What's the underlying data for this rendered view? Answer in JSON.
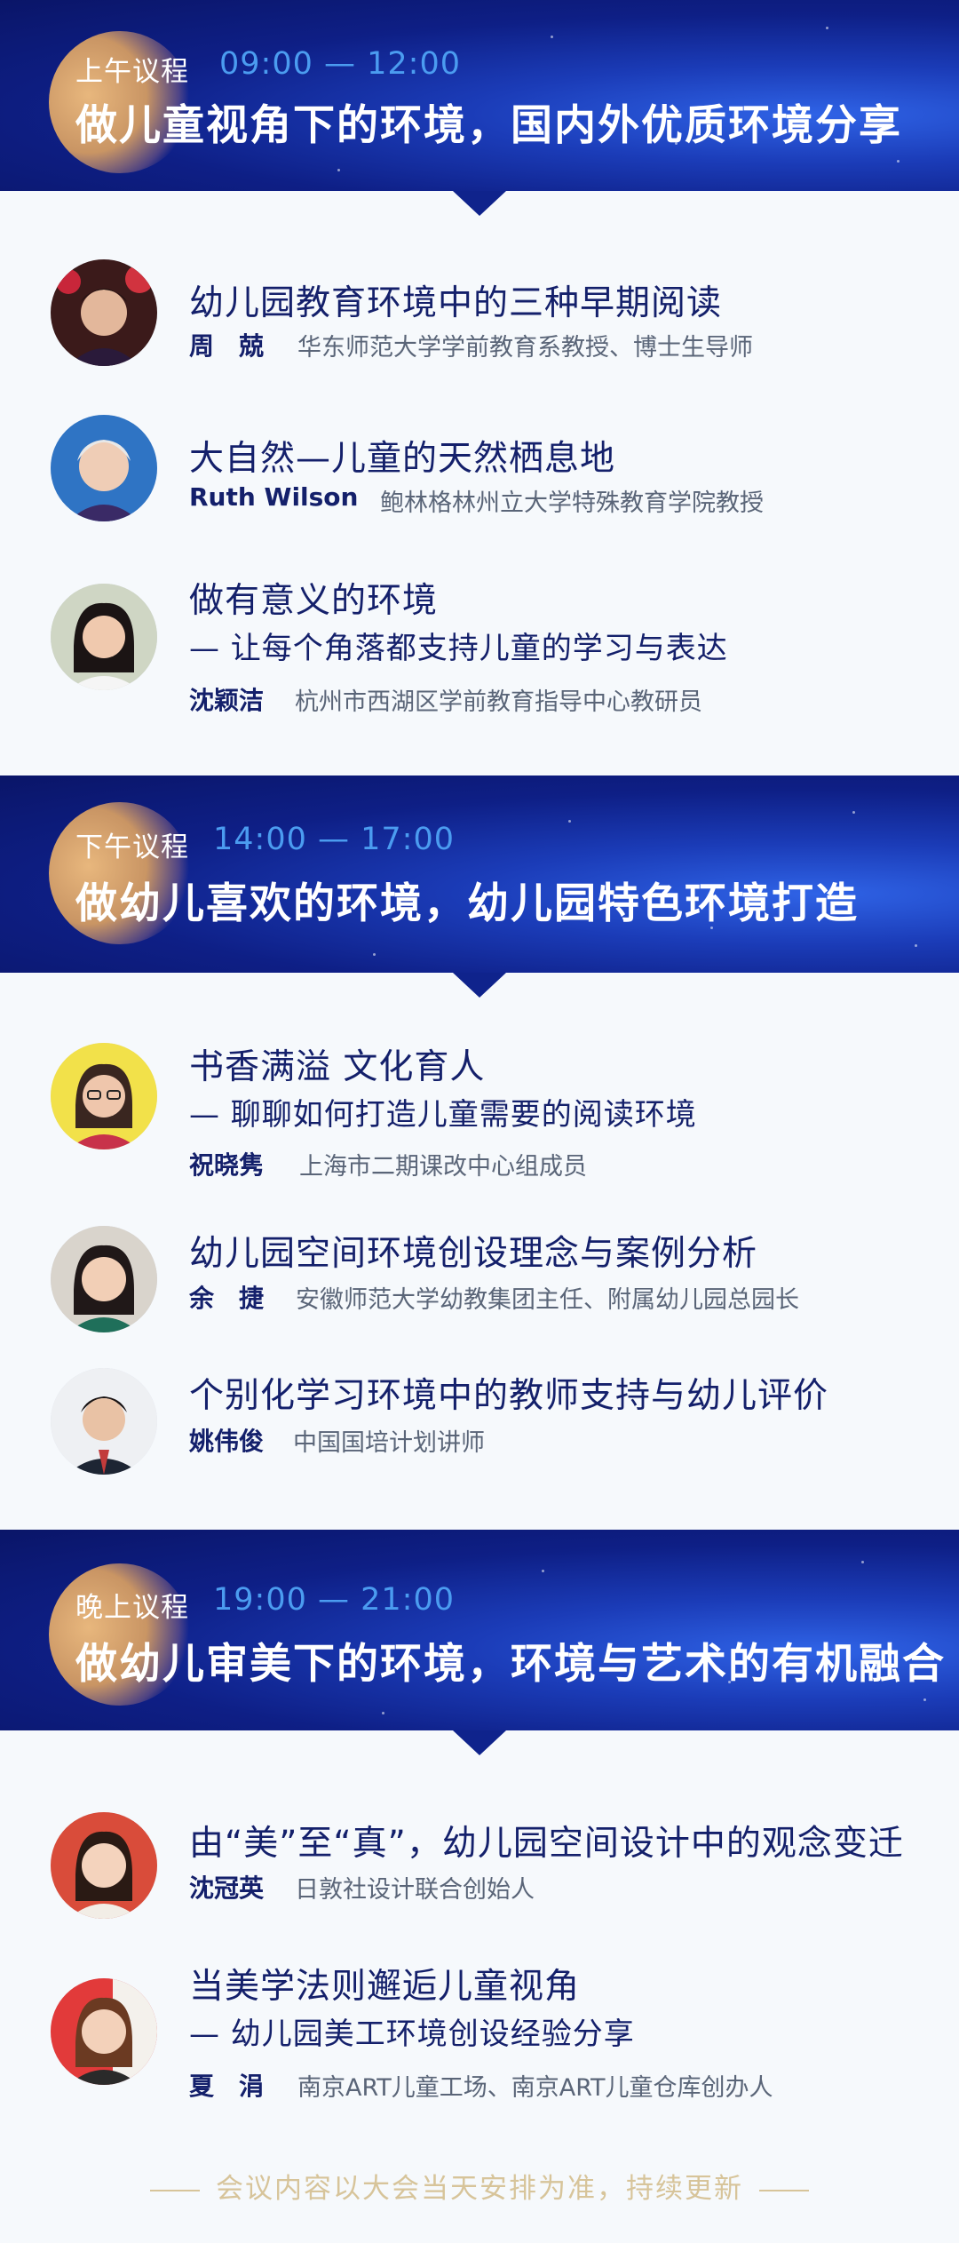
{
  "sections": [
    {
      "label": "上午议程",
      "time": "09:00 — 12:00",
      "title": "做儿童视角下的环境，国内外优质环境分享",
      "talks": [
        {
          "title": "幼儿园教育环境中的三种早期阅读",
          "subtitle": "",
          "name": "周　兢",
          "affiliation": "华东师范大学学前教育系教授、博士生导师"
        },
        {
          "title": "大自然—儿童的天然栖息地",
          "subtitle": "",
          "name": "Ruth  Wilson",
          "affiliation": "鲍林格林州立大学特殊教育学院教授"
        },
        {
          "title": "做有意义的环境",
          "subtitle": "— 让每个角落都支持儿童的学习与表达",
          "name": "沈颖洁",
          "affiliation": "杭州市西湖区学前教育指导中心教研员"
        }
      ]
    },
    {
      "label": "下午议程",
      "time": "14:00 — 17:00",
      "title": "做幼儿喜欢的环境，幼儿园特色环境打造",
      "talks": [
        {
          "title": "书香满溢  文化育人",
          "subtitle": "— 聊聊如何打造儿童需要的阅读环境",
          "name": "祝晓隽",
          "affiliation": "上海市二期课改中心组成员"
        },
        {
          "title": "幼儿园空间环境创设理念与案例分析",
          "subtitle": "",
          "name": "余　捷",
          "affiliation": "安徽师范大学幼教集团主任、附属幼儿园总园长"
        },
        {
          "title": "个别化学习环境中的教师支持与幼儿评价",
          "subtitle": "",
          "name": "姚伟俊",
          "affiliation": "中国国培计划讲师"
        }
      ]
    },
    {
      "label": "晚上议程",
      "time": "19:00 — 21:00",
      "title": "做幼儿审美下的环境，环境与艺术的有机融合",
      "talks": [
        {
          "title": "由“美”至“真”，幼儿园空间设计中的观念变迁",
          "subtitle": "",
          "name": "沈冠英",
          "affiliation": "日敦社设计联合创始人"
        },
        {
          "title": "当美学法则邂逅儿童视角",
          "subtitle": "— 幼儿园美工环境创设经验分享",
          "name": "夏　涓",
          "affiliation": "南京ART儿童工场、南京ART儿童仓库创办人"
        }
      ]
    }
  ],
  "footer": "会议内容以大会当天安排为准，持续更新",
  "colors": {
    "header_dark": "#0a1568",
    "header_light": "#2f63e6",
    "time": "#4b9cf0",
    "text": "#14206b",
    "footer": "#d7c49a"
  }
}
